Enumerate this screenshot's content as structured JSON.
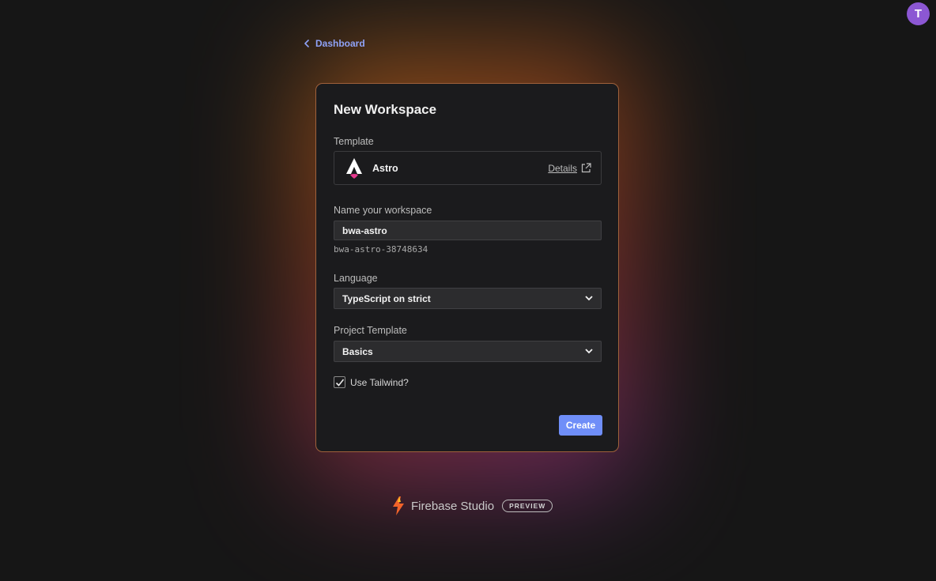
{
  "user": {
    "avatar_initial": "T",
    "avatar_color": "#8c57d3"
  },
  "nav": {
    "back_label": "Dashboard"
  },
  "form": {
    "title": "New Workspace",
    "template_label": "Template",
    "template": {
      "name": "Astro",
      "details_label": "Details",
      "logo": "astro-logo-icon"
    },
    "name_label": "Name your workspace",
    "name_value": "bwa-astro",
    "workspace_id": "bwa-astro-38748634",
    "language_label": "Language",
    "language_value": "TypeScript on strict",
    "project_template_label": "Project Template",
    "project_template_value": "Basics",
    "tailwind_label": "Use Tailwind?",
    "tailwind_checked": true,
    "create_label": "Create"
  },
  "footer": {
    "brand": "Firebase Studio",
    "badge": "PREVIEW"
  },
  "colors": {
    "accent": "#6f8ef8",
    "link": "#8fa2f7",
    "background": "#161616",
    "card": "#1b1b1d"
  }
}
